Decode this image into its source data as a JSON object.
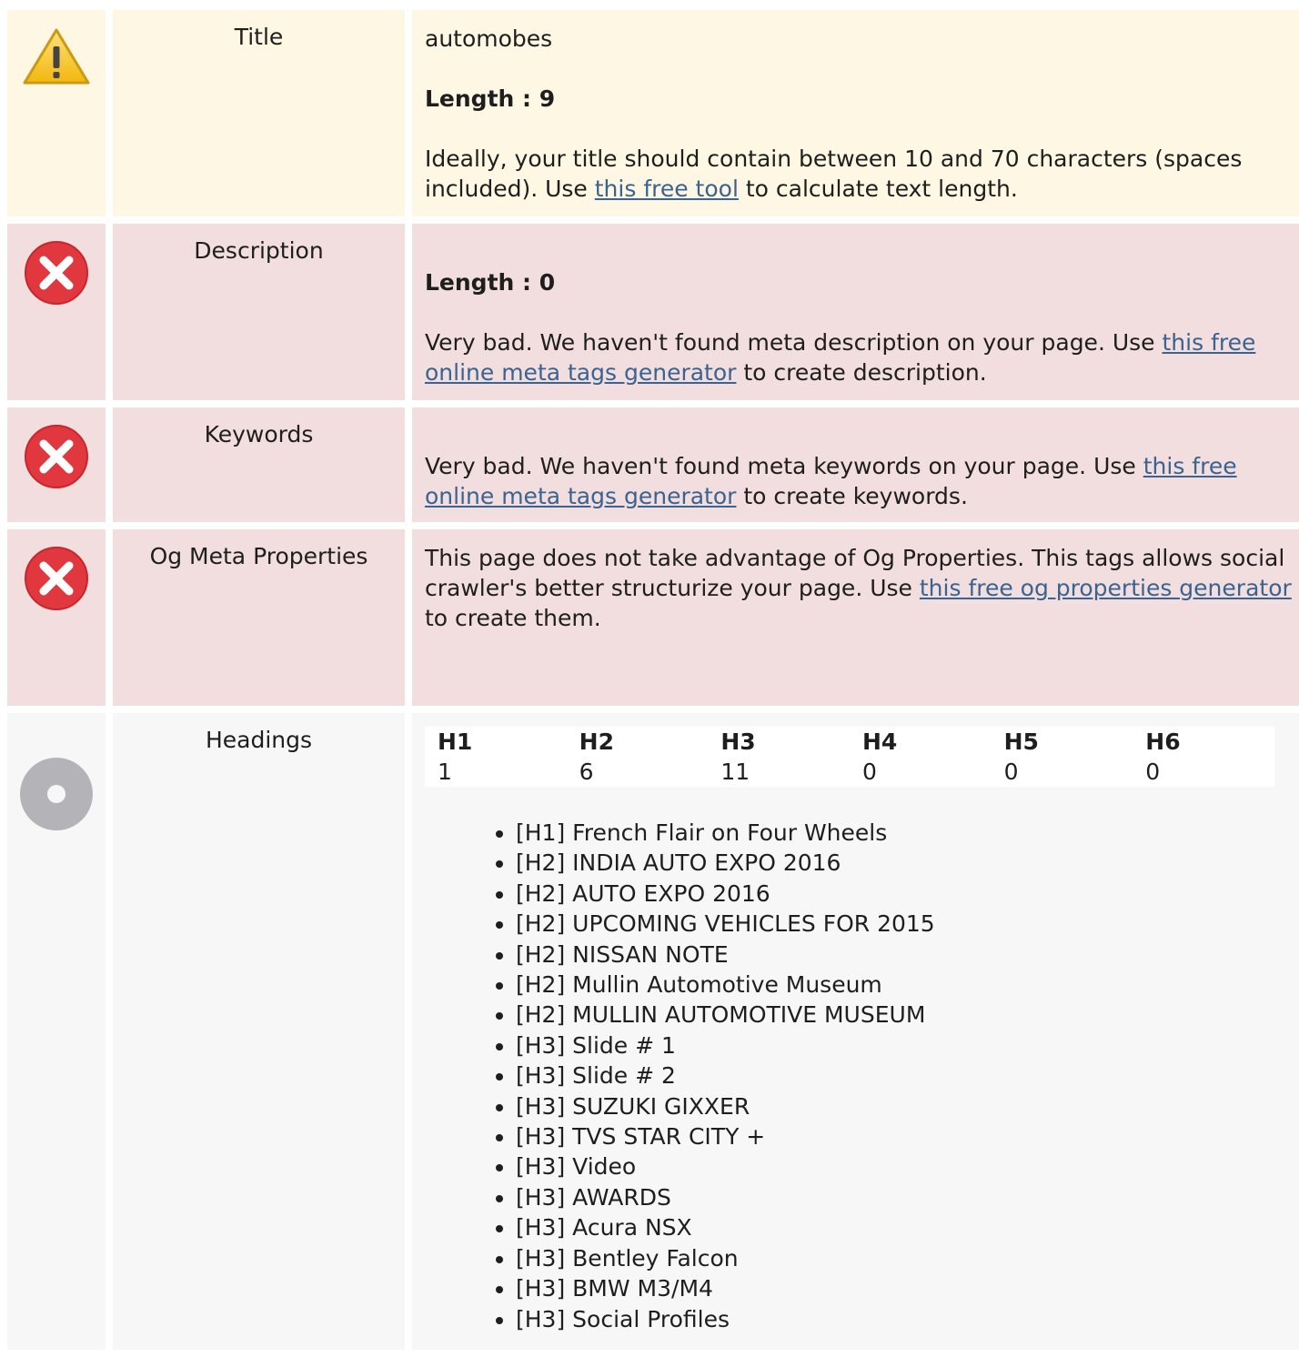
{
  "title_row": {
    "label": "Title",
    "value": "automobes",
    "length_label": "Length : 9",
    "advice_before": "Ideally, your title should contain between 10 and 70 characters (spaces included). Use ",
    "link": "this free tool",
    "advice_after": " to calculate text length."
  },
  "description_row": {
    "label": "Description",
    "length_label": "Length : 0",
    "advice_before": "Very bad. We haven't found meta description on your page. Use ",
    "link": "this free online meta tags generator",
    "advice_after": " to create description."
  },
  "keywords_row": {
    "label": "Keywords",
    "advice_before": "Very bad. We haven't found meta keywords on your page. Use ",
    "link": "this free online meta tags generator",
    "advice_after": " to create keywords."
  },
  "og_row": {
    "label": "Og Meta Properties",
    "advice_before": "This page does not take advantage of Og Properties. This tags allows social crawler's better structurize your page. Use ",
    "link": "this free og properties generator",
    "advice_after": " to create them."
  },
  "headings_row": {
    "label": "Heading",
    "label_full": "Headings",
    "columns": [
      "H1",
      "H2",
      "H3",
      "H4",
      "H5",
      "H6"
    ],
    "counts": [
      "1",
      "6",
      "11",
      "0",
      "0",
      "0"
    ],
    "items": [
      "[H1] French Flair on Four Wheels",
      "[H2] INDIA AUTO EXPO 2016",
      "[H2] AUTO EXPO 2016",
      "[H2] UPCOMING VEHICLES FOR 2015",
      "[H2] NISSAN NOTE",
      "[H2] Mullin Automotive Museum",
      "[H2] MULLIN AUTOMOTIVE MUSEUM",
      "[H3] Slide # 1",
      "[H3] Slide # 2",
      "[H3] SUZUKI GIXXER",
      "[H3] TVS STAR CITY +",
      "[H3] Video",
      "[H3] AWARDS",
      "[H3] Acura NSX",
      "[H3] Bentley Falcon",
      "[H3] BMW M3/M4",
      "[H3] Social Profiles"
    ]
  },
  "colors": {
    "warning_bg": "#fdf7e3",
    "error_bg": "#f2dede",
    "info_bg": "#f7f7f7",
    "link": "#3a6390",
    "error_icon": "#e0383e",
    "warning_icon": "#f5c518",
    "info_icon": "#b4b4b8"
  }
}
